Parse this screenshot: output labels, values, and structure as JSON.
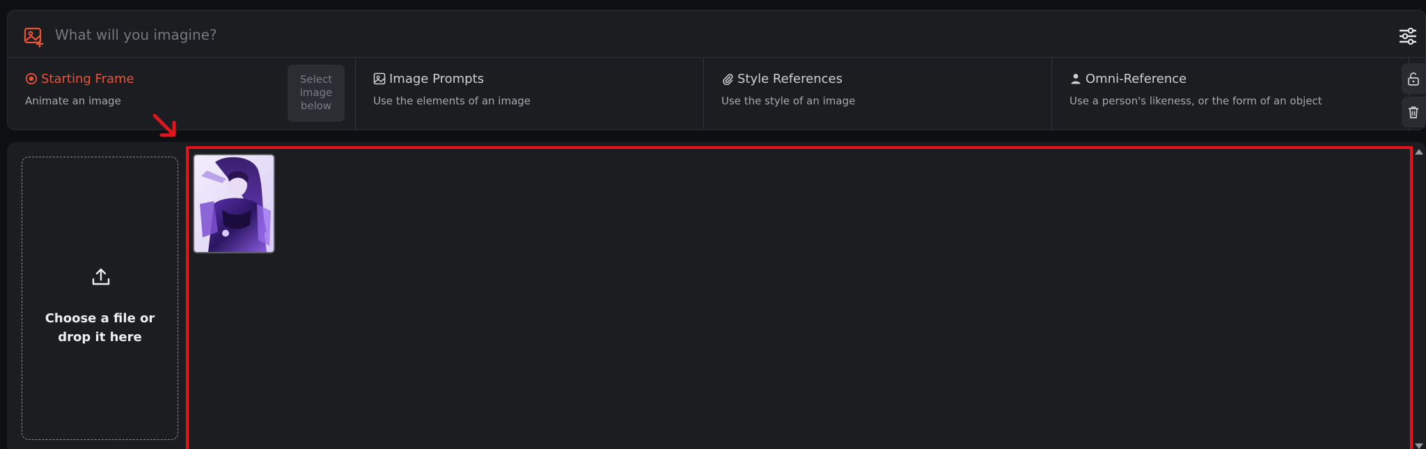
{
  "prompt": {
    "placeholder": "What will you imagine?",
    "value": ""
  },
  "tabs": [
    {
      "title": "Starting Frame",
      "subtitle": "Animate an image",
      "icon": "target-circle-icon",
      "active": true
    },
    {
      "title": "Image Prompts",
      "subtitle": "Use the elements of an image",
      "icon": "image-icon",
      "active": false
    },
    {
      "title": "Style References",
      "subtitle": "Use the style of an image",
      "icon": "paperclip-icon",
      "active": false
    },
    {
      "title": "Omni-Reference",
      "subtitle": "Use a person's likeness, or the form of an object",
      "icon": "person-icon",
      "active": false
    }
  ],
  "starting_frame_hint": "Select\nimage\nbelow",
  "side_buttons": [
    "unlock-icon",
    "trash-icon"
  ],
  "dropzone": {
    "text": "Choose a file or\ndrop it here",
    "icon": "upload-icon"
  },
  "gallery": {
    "thumbnails": [
      {
        "alt": "anime character portrait in purple tones"
      }
    ]
  },
  "colors": {
    "accent": "#e9533a",
    "panel": "#1c1d21",
    "background": "#0e0f12",
    "highlight_box": "#e3131b"
  }
}
